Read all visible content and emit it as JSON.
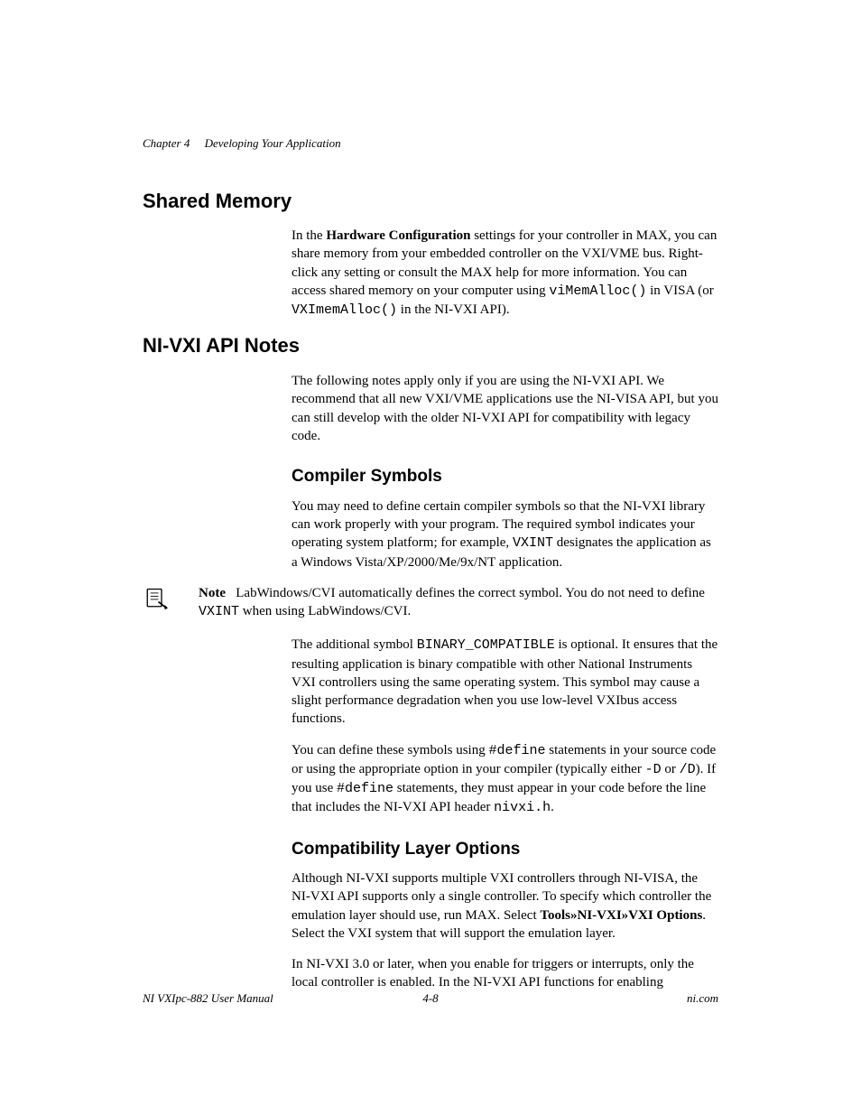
{
  "header": {
    "chapter": "Chapter 4",
    "title": "Developing Your Application"
  },
  "sections": {
    "shared_memory": {
      "heading": "Shared Memory",
      "p1_a": "In the ",
      "p1_b": "Hardware Configuration",
      "p1_c": " settings for your controller in MAX, you can share memory from your embedded controller on the VXI/VME bus. Right-click any setting or consult the MAX help for more information. You can access shared memory on your computer using ",
      "p1_code1": "viMemAlloc()",
      "p1_d": " in VISA (or ",
      "p1_code2": "VXImemAlloc()",
      "p1_e": " in the NI-VXI API)."
    },
    "api_notes": {
      "heading": "NI-VXI API Notes",
      "p1": "The following notes apply only if you are using the NI-VXI API. We recommend that all new VXI/VME applications use the NI-VISA API, but you can still develop with the older NI-VXI API for compatibility with legacy code."
    },
    "compiler": {
      "heading": "Compiler Symbols",
      "p1_a": "You may need to define certain compiler symbols so that the NI-VXI library can work properly with your program. The required symbol indicates your operating system platform; for example, ",
      "p1_code1": "VXINT",
      "p1_b": " designates the application as a Windows Vista/XP/2000/Me/9x/NT application.",
      "note_label": "Note",
      "note_a": "LabWindows/CVI automatically defines the correct symbol. You do not need to define ",
      "note_code": "VXINT",
      "note_b": " when using LabWindows/CVI.",
      "p2_a": "The additional symbol ",
      "p2_code1": "BINARY_COMPATIBLE",
      "p2_b": " is optional. It ensures that the resulting application is binary compatible with other National Instruments VXI controllers using the same operating system. This symbol may cause a slight performance degradation when you use low-level VXIbus access functions.",
      "p3_a": "You can define these symbols using ",
      "p3_code1": "#define",
      "p3_b": " statements in your source code or using the appropriate option in your compiler (typically either ",
      "p3_code2": "-D",
      "p3_c": " or ",
      "p3_code3": "/D",
      "p3_d": "). If you use ",
      "p3_code4": "#define",
      "p3_e": " statements, they must appear in your code before the line that includes the NI-VXI API header ",
      "p3_code5": "nivxi.h",
      "p3_f": "."
    },
    "compat": {
      "heading": "Compatibility Layer Options",
      "p1_a": "Although NI-VXI supports multiple VXI controllers through NI-VISA, the NI-VXI API supports only a single controller. To specify which controller the emulation layer should use, run MAX. Select ",
      "p1_b": "Tools»NI-VXI»VXI Options",
      "p1_c": ". Select the VXI system that will support the emulation layer.",
      "p2": "In NI-VXI 3.0 or later, when you enable for triggers or interrupts, only the local controller is enabled. In the NI-VXI API functions for enabling"
    }
  },
  "footer": {
    "left": "NI VXIpc-882 User Manual",
    "center": "4-8",
    "right": "ni.com"
  }
}
